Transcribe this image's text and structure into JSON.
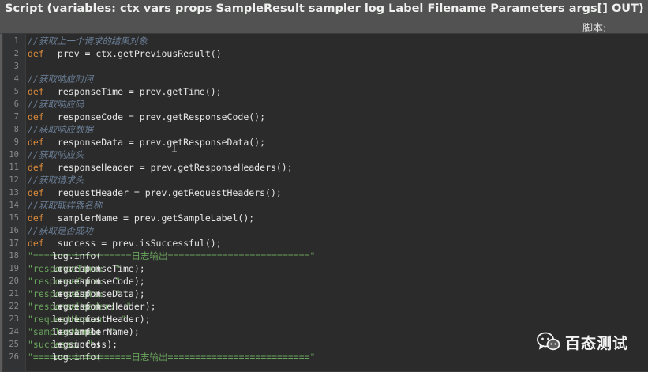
{
  "header": {
    "title": "Script (variables: ctx vars props SampleResult sampler log Label Filename Parameters args[] OUT)",
    "script_label": "脚本:"
  },
  "editor": {
    "lines": [
      {
        "n": "1",
        "segments": [
          {
            "t": "//获取上一个请求的结果对象",
            "c": "comment"
          },
          {
            "t": "",
            "c": "cursor"
          }
        ]
      },
      {
        "n": "2",
        "segments": [
          {
            "t": "def",
            "c": "kw"
          },
          {
            "t": " prev = ctx.getPreviousResult()",
            "c": "code"
          }
        ]
      },
      {
        "n": "3",
        "segments": []
      },
      {
        "n": "4",
        "segments": [
          {
            "t": "//获取响应时间",
            "c": "comment"
          }
        ]
      },
      {
        "n": "5",
        "segments": [
          {
            "t": "def",
            "c": "kw"
          },
          {
            "t": " responseTime = prev.getTime();",
            "c": "code"
          }
        ]
      },
      {
        "n": "6",
        "segments": [
          {
            "t": "//获取响应码",
            "c": "comment"
          }
        ]
      },
      {
        "n": "7",
        "segments": [
          {
            "t": "def",
            "c": "kw"
          },
          {
            "t": " responseCode = prev.getResponseCode();",
            "c": "code"
          }
        ]
      },
      {
        "n": "8",
        "segments": [
          {
            "t": "//获取响应数据",
            "c": "comment"
          }
        ]
      },
      {
        "n": "9",
        "segments": [
          {
            "t": "def",
            "c": "kw"
          },
          {
            "t": " responseData = prev.getResponseData();",
            "c": "code"
          }
        ]
      },
      {
        "n": "10",
        "segments": [
          {
            "t": "//获取响应头",
            "c": "comment"
          }
        ]
      },
      {
        "n": "11",
        "segments": [
          {
            "t": "def",
            "c": "kw"
          },
          {
            "t": " responseHeader = prev.getResponseHeaders();",
            "c": "code"
          }
        ]
      },
      {
        "n": "12",
        "segments": [
          {
            "t": "//获取请求头",
            "c": "comment"
          }
        ]
      },
      {
        "n": "13",
        "segments": [
          {
            "t": "def",
            "c": "kw"
          },
          {
            "t": " requestHeader = prev.getRequestHeaders();",
            "c": "code"
          }
        ]
      },
      {
        "n": "14",
        "segments": [
          {
            "t": "//获取取样器名称",
            "c": "comment"
          }
        ]
      },
      {
        "n": "15",
        "segments": [
          {
            "t": "def",
            "c": "kw"
          },
          {
            "t": " samplerName = prev.getSampleLabel();",
            "c": "code"
          }
        ]
      },
      {
        "n": "16",
        "segments": [
          {
            "t": "//获取是否成功",
            "c": "comment"
          }
        ]
      },
      {
        "n": "17",
        "segments": [
          {
            "t": "def",
            "c": "kw"
          },
          {
            "t": " success = prev.isSuccessful();",
            "c": "code"
          }
        ]
      },
      {
        "n": "18",
        "segments": [
          {
            "t": "log.info(",
            "c": "code"
          },
          {
            "t": "\"==================日志输出==========================\"",
            "c": "str"
          },
          {
            "t": ")",
            "c": "code"
          }
        ]
      },
      {
        "n": "19",
        "segments": [
          {
            "t": "log.info(",
            "c": "code"
          },
          {
            "t": "\"responseTime:  \"",
            "c": "str"
          },
          {
            "t": " + responseTime);",
            "c": "code"
          }
        ]
      },
      {
        "n": "20",
        "segments": [
          {
            "t": "log.info(",
            "c": "code"
          },
          {
            "t": "\"responseCode:  \"",
            "c": "str"
          },
          {
            "t": " + responseCode);",
            "c": "code"
          }
        ]
      },
      {
        "n": "21",
        "segments": [
          {
            "t": "log.info(",
            "c": "code"
          },
          {
            "t": "\"responseData:  \"",
            "c": "str"
          },
          {
            "t": " + responseData);",
            "c": "code"
          }
        ]
      },
      {
        "n": "22",
        "segments": [
          {
            "t": "log.info(",
            "c": "code"
          },
          {
            "t": "\"responseHeader:  \"",
            "c": "str"
          },
          {
            "t": " + responseHeader);",
            "c": "code"
          }
        ]
      },
      {
        "n": "23",
        "segments": [
          {
            "t": "log.info(",
            "c": "code"
          },
          {
            "t": "\"requestHeader:  \"",
            "c": "str"
          },
          {
            "t": " + requestHeader);",
            "c": "code"
          }
        ]
      },
      {
        "n": "24",
        "segments": [
          {
            "t": "log.info(",
            "c": "code"
          },
          {
            "t": "\"samplerName:  \"",
            "c": "str"
          },
          {
            "t": " + samplerName);",
            "c": "code"
          }
        ]
      },
      {
        "n": "25",
        "segments": [
          {
            "t": "log.info(",
            "c": "code"
          },
          {
            "t": "\"success:  \"",
            "c": "str"
          },
          {
            "t": " + success);",
            "c": "code"
          }
        ]
      },
      {
        "n": "26",
        "segments": [
          {
            "t": "log.info(",
            "c": "code"
          },
          {
            "t": "\"==================日志输出==========================\"",
            "c": "str"
          },
          {
            "t": ")",
            "c": "code"
          }
        ]
      }
    ]
  },
  "watermark": {
    "text": "百态测试",
    "icon": "wechat-icon"
  },
  "colors": {
    "keyword": "#d98a3b",
    "comment": "#6b7f97",
    "string": "#6aa55d",
    "code": "#e6e6e6",
    "background": "#2b2b2b"
  }
}
